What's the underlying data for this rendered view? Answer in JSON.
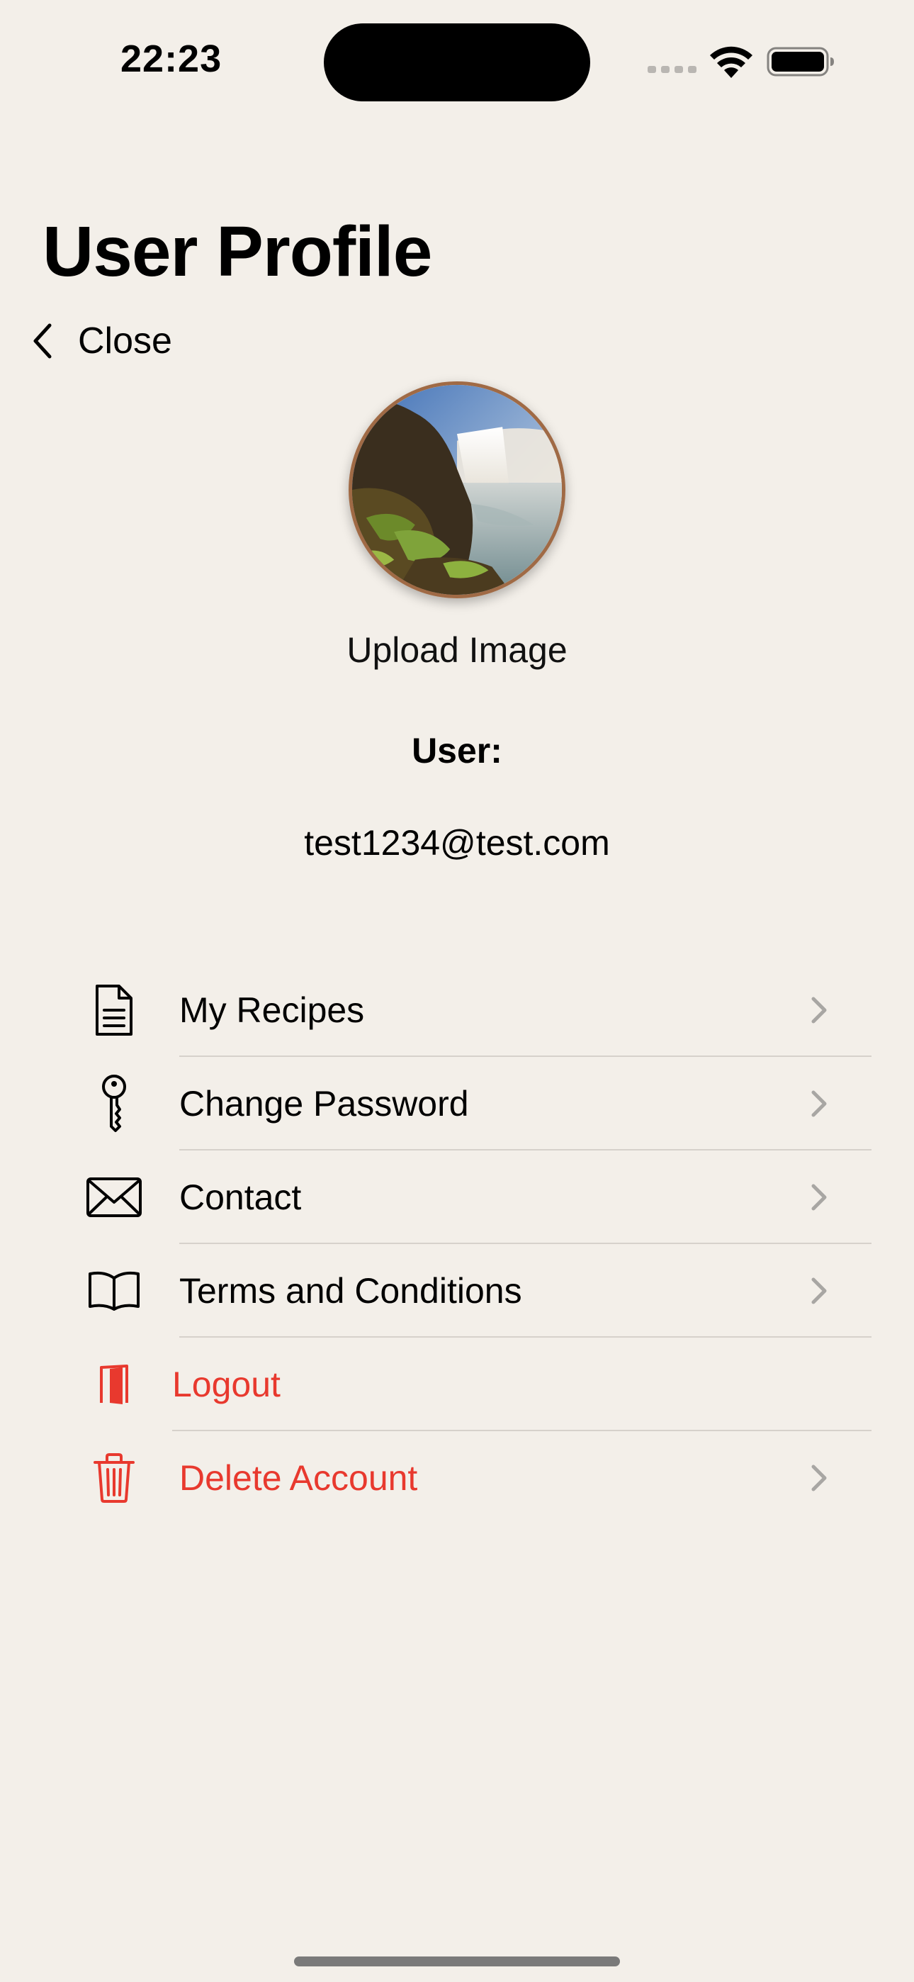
{
  "status_bar": {
    "time": "22:23"
  },
  "header": {
    "title": "User Profile",
    "back_label": "Close"
  },
  "profile": {
    "upload_label": "Upload Image",
    "user_label": "User:",
    "email": "test1234@test.com"
  },
  "menu": {
    "items": [
      {
        "label": "My Recipes",
        "icon": "document-icon",
        "chevron": true
      },
      {
        "label": "Change Password",
        "icon": "key-icon",
        "chevron": true
      },
      {
        "label": "Contact",
        "icon": "envelope-icon",
        "chevron": true
      },
      {
        "label": "Terms and Conditions",
        "icon": "book-icon",
        "chevron": true
      },
      {
        "label": "Logout",
        "icon": "door-icon",
        "chevron": false
      },
      {
        "label": "Delete Account",
        "icon": "trash-icon",
        "chevron": true
      }
    ]
  },
  "colors": {
    "background": "#F3EFE9",
    "destructive": "#E8392E",
    "avatar_border": "#A06A45",
    "chevron": "#A8A6A3",
    "divider": "#D6D1CB"
  }
}
